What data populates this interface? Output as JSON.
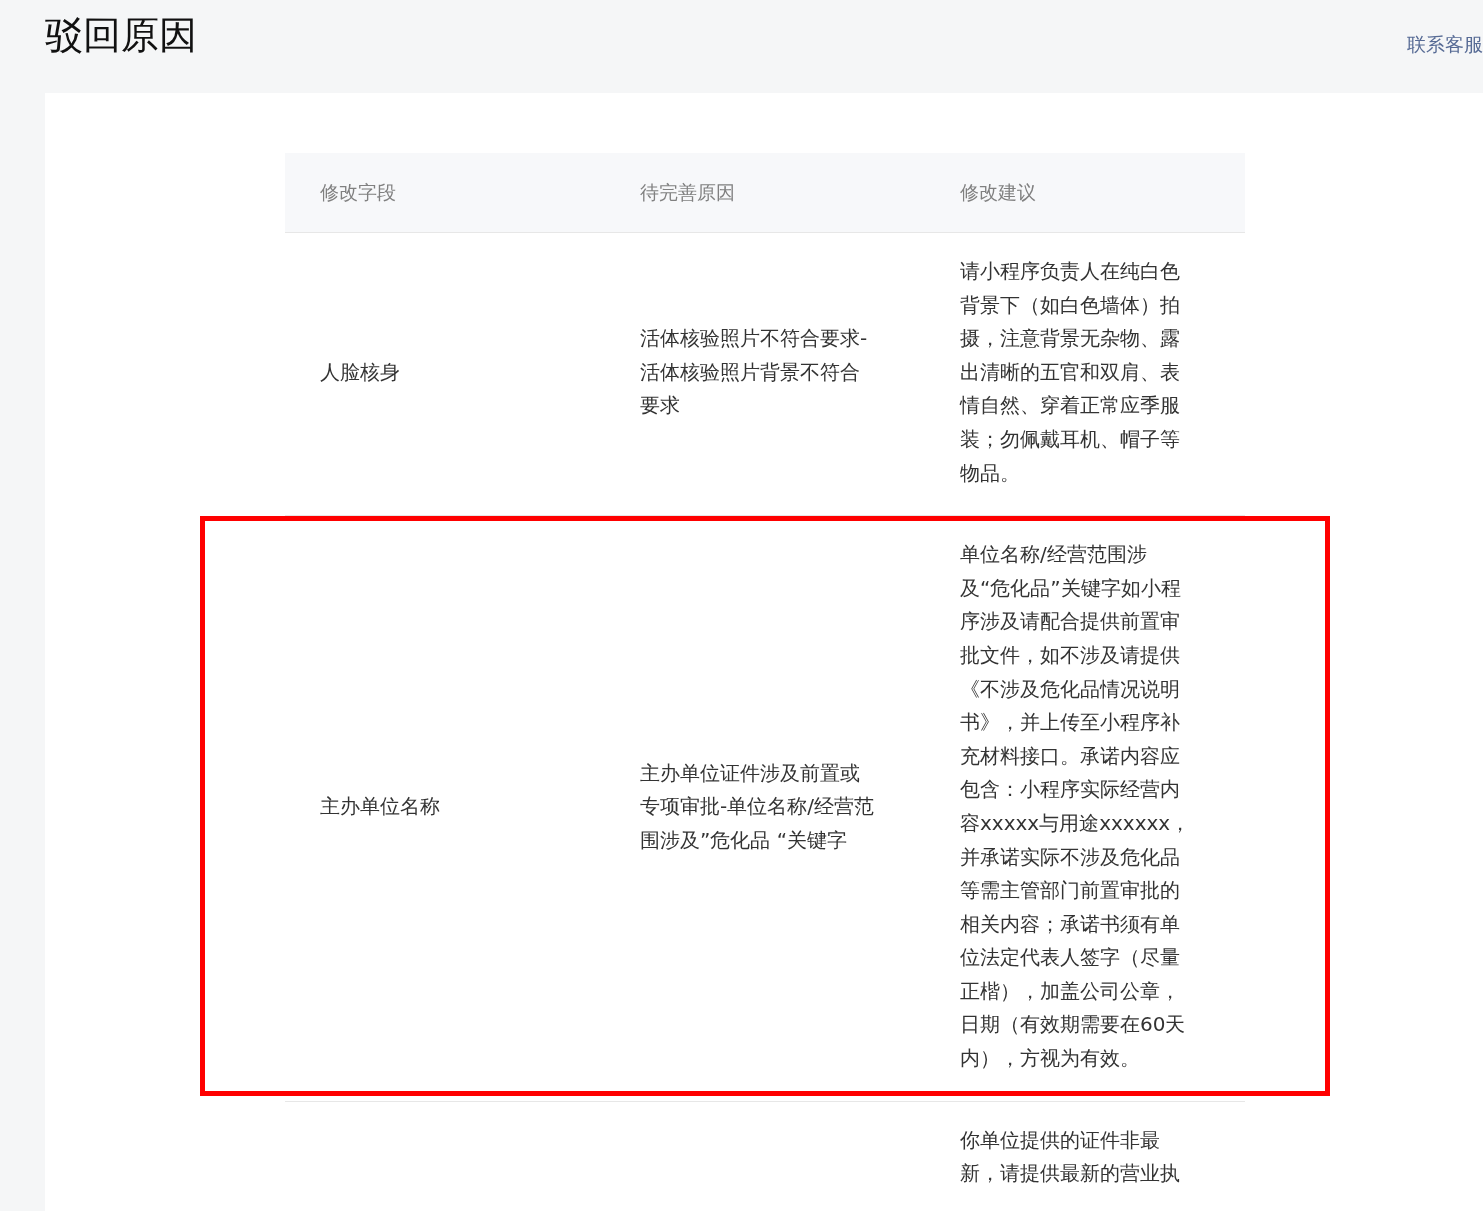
{
  "page": {
    "title": "驳回原因",
    "contact_link": "联系客服"
  },
  "table": {
    "columns": [
      "修改字段",
      "待完善原因",
      "修改建议"
    ],
    "rows": [
      {
        "highlighted": false,
        "cells": [
          "人脸核身",
          "活体核验照片不符合要求-活体核验照片背景不符合要求",
          "请小程序负责人在纯白色背景下（如白色墙体）拍摄，注意背景无杂物、露出清晰的五官和双肩、表情自然、穿着正常应季服装；勿佩戴耳机、帽子等物品。"
        ]
      },
      {
        "highlighted": true,
        "cells": [
          "主办单位名称",
          "主办单位证件涉及前置或专项审批-单位名称/经营范围涉及”危化品 “关键字",
          "单位名称/经营范围涉及“危化品”关键字如小程序涉及请配合提供前置审批文件，如不涉及请提供《不涉及危化品情况说明书》，并上传至小程序补充材料接口。承诺内容应包含：小程序实际经营内容xxxxx与用途xxxxxx，并承诺实际不涉及危化品等需主管部门前置审批的相关内容；承诺书须有单位法定代表人签字（尽量正楷），加盖公司公章，日期（有效期需要在60天内），方视为有效。"
        ]
      },
      {
        "highlighted": false,
        "cells": [
          "",
          "",
          "你单位提供的证件非最新，请提供最新的营业执"
        ]
      }
    ]
  }
}
